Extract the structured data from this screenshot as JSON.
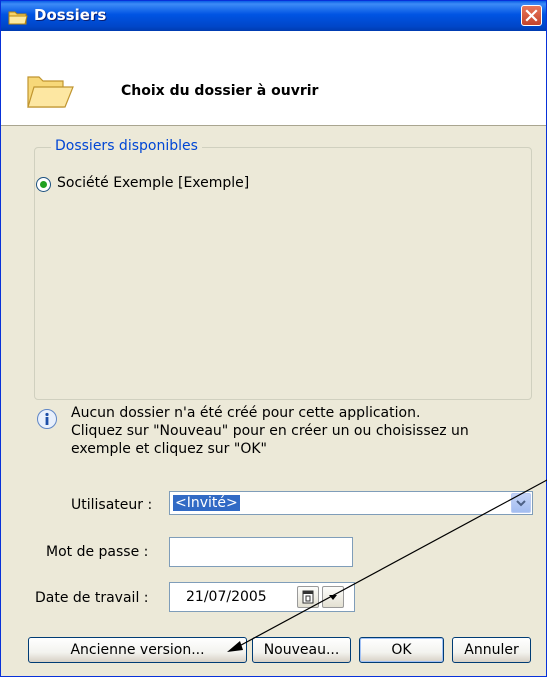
{
  "window": {
    "title": "Dossiers",
    "header_text": "Choix du dossier à ouvrir",
    "title_icon": "folder-icon",
    "close_icon": "close-icon"
  },
  "groupbox": {
    "legend": "Dossiers disponibles",
    "items": [
      {
        "label": "Société Exemple [Exemple]",
        "selected": true
      }
    ]
  },
  "info": {
    "icon": "info-icon",
    "lines": [
      "Aucun dossier n'a été créé pour cette application.",
      "Cliquez sur \"Nouveau\" pour en créer un ou choisissez un",
      "exemple et cliquez sur \"OK\""
    ]
  },
  "form": {
    "user_label": "Utilisateur :",
    "user_value": "<Invité>",
    "password_label": "Mot de passe :",
    "password_value": "",
    "date_label": "Date de travail :",
    "date_value": "21/07/2005"
  },
  "buttons": {
    "old_version": "Ancienne version...",
    "new": "Nouveau...",
    "ok": "OK",
    "cancel": "Annuler"
  },
  "colors": {
    "titlebar": "#0054e3",
    "face": "#ece9d8",
    "legend": "#0046d5",
    "selection": "#316ac5"
  }
}
